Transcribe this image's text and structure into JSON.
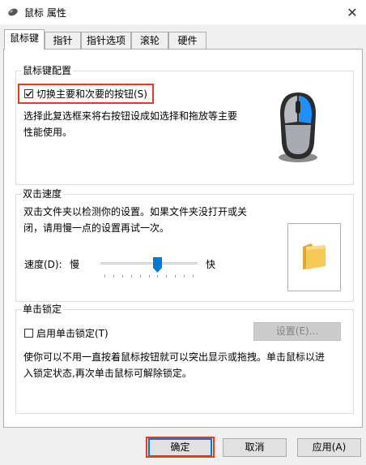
{
  "window": {
    "title": "鼠标 属性",
    "close_glyph": "✕"
  },
  "tabs": [
    {
      "label": "鼠标键",
      "active": true
    },
    {
      "label": "指针",
      "active": false
    },
    {
      "label": "指针选项",
      "active": false
    },
    {
      "label": "滚轮",
      "active": false
    },
    {
      "label": "硬件",
      "active": false
    }
  ],
  "button_config": {
    "title": "鼠标键配置",
    "swap_checkbox": {
      "label": "切换主要和次要的按钮(S)",
      "checked": true
    },
    "description_line1": "选择此复选框来将右按钮设成如选择和拖放等主要",
    "description_line2": "性能使用。",
    "mouse_icon": "mouse-icon"
  },
  "double_click": {
    "title": "双击速度",
    "description_line1": "双击文件夹以检测你的设置。如果文件夹没打开或关",
    "description_line2": "闭，请用慢一点的设置再试一次。",
    "speed_label": "速度(D):",
    "slow_label": "慢",
    "fast_label": "快",
    "speed_level": 0.6,
    "folder_icon": "folder-icon"
  },
  "click_lock": {
    "title": "单击锁定",
    "checkbox": {
      "label": "启用单击锁定(T)",
      "checked": false
    },
    "settings_button": "设置(E)...",
    "description_line1": "使你可以不用一直按着鼠标按钮就可以突出显示或拖拽。单击鼠标以进",
    "description_line2": "入锁定状态,再次单击鼠标可解除锁定。"
  },
  "footer": {
    "ok": "确定",
    "cancel": "取消",
    "apply": "应用(A)"
  },
  "colors": {
    "highlight": "#e53b1f",
    "accent": "#0078d7",
    "folder": "#f5c956"
  }
}
